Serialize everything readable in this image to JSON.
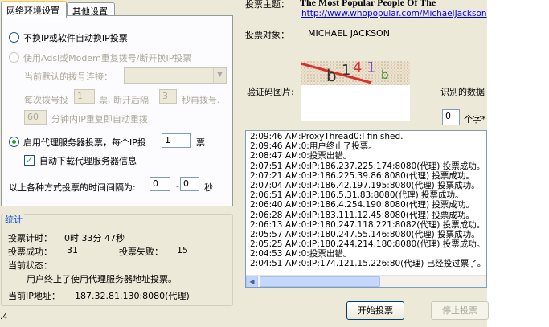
{
  "tabs": [
    {
      "label": "网络环境设置",
      "active": true
    },
    {
      "label": "其他设置",
      "active": false
    }
  ],
  "network": {
    "opt_no_change_ip": "不换IP或软件自动换IP投票",
    "opt_redial": "使用Adsl或Modem重复拨号/断开换IP投票",
    "current_dial_label": "当前默认的拨号连接：",
    "each_dial_vote_prefix": "每次拨号投",
    "each_dial_vote_value": "1",
    "each_dial_vote_mid": "票, 断开后隔",
    "redial_wait_value": "3",
    "redial_wait_suffix": "秒再拨号.",
    "auto_redial_minutes_value": "60",
    "auto_redial_suffix": "分钟内IP重复即自动重拨",
    "opt_proxy": "启用代理服务器投票，每个IP投",
    "proxy_votes_value": "1",
    "proxy_votes_unit": "票",
    "auto_download_proxy": "自动下载代理服务器信息",
    "interval_label": "以上各种方式投票的时间间隔为:",
    "interval_min": "0",
    "interval_sep": "~",
    "interval_max": "0",
    "interval_unit": "秒"
  },
  "stats": {
    "title": "统计",
    "vote_time_label": "投票计时：",
    "vote_time_value": "0时 33分 47秒",
    "success_label": "投票成功：",
    "success_value": "31",
    "fail_label": "投票失败：",
    "fail_value": "15",
    "status_label": "当前状态：",
    "status_value": "用户终止了使用代理服务器地址投票。",
    "ip_label": "当前IP地址：",
    "ip_value": "187.32.81.130:8080(代理)"
  },
  "version_fragment": ".4",
  "vote": {
    "topic_label": "投票主题：",
    "topic_value": "The Most Popular People Of The",
    "topic_url": "http://www.whopopular.com/MichaelJackson",
    "target_label": "投票对象：",
    "target_value": "MICHAEL JACKSON",
    "captcha_label": "验证码图片:",
    "captcha_text": [
      "b",
      "1",
      "4",
      "1",
      "b"
    ],
    "recognized_label": "识别的数据",
    "char_count_value": "0",
    "char_count_suffix": "个字*"
  },
  "log": [
    "2:09:46 AM:ProxyThread0:I finished.",
    "2:09:46 AM:0:用户终止了投票。",
    "2:08:47 AM:0:投票出错。",
    "2:07:51 AM:0:IP:186.237.225.174:8080(代理) 投票成功。",
    "2:07:21 AM:0:IP:186.225.39.86:8080(代理) 投票成功。",
    "2:07:04 AM:0:IP:186.42.197.195:8080(代理) 投票成功。",
    "2:06:51 AM:0:IP:186.5.31.83:8080(代理) 投票成功。",
    "2:06:40 AM:0:IP:186.4.254.190:8080(代理) 投票成功。",
    "2:06:28 AM:0:IP:183.111.12.45:8080(代理) 投票成功。",
    "2:06:13 AM:0:IP:180.247.118.221:8082(代理) 投票成功。",
    "2:05:57 AM:0:IP:180.247.55.146:8080(代理) 投票成功。",
    "2:05:25 AM:0:IP:180.244.214.180:8080(代理) 投票成功。",
    "2:04:53 AM:0:投票出错。",
    "2:04:51 AM:0:IP:174.121.15.226:80(代理) 已经投过票了。"
  ],
  "buttons": {
    "start": "开始投票",
    "stop": "停止投票"
  },
  "colors": {
    "accent_title": "#0046d5",
    "link": "#0000ee",
    "radio_dot": "#21a121"
  }
}
